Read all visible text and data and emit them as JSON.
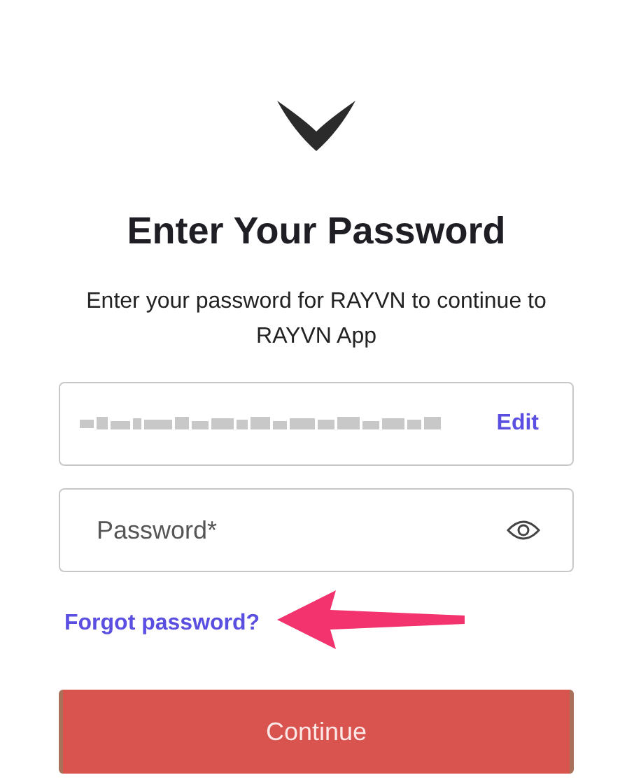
{
  "title": "Enter Your Password",
  "subtitle": "Enter your password for RAYVN to continue to RAYVN App",
  "email_field": {
    "action": "Edit"
  },
  "password_field": {
    "placeholder": "Password*"
  },
  "forgot_link": "Forgot password?",
  "continue_button": "Continue"
}
